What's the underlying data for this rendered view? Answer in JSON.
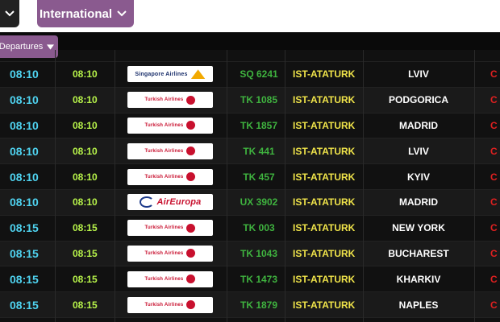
{
  "header": {
    "tab_international": "International",
    "departures_label": "Departures"
  },
  "flights": [
    {
      "scheduled": "08:10",
      "actual": "08:10",
      "airline": "Singapore Airlines",
      "logo": "sq",
      "flight": "SQ 6241",
      "from": "IST-ATATURK",
      "city": "LVIV",
      "status": "C"
    },
    {
      "scheduled": "08:10",
      "actual": "08:10",
      "airline": "Turkish Airlines",
      "logo": "tk",
      "flight": "TK 1085",
      "from": "IST-ATATURK",
      "city": "PODGORICA",
      "status": "C"
    },
    {
      "scheduled": "08:10",
      "actual": "08:10",
      "airline": "Turkish Airlines",
      "logo": "tk",
      "flight": "TK 1857",
      "from": "IST-ATATURK",
      "city": "MADRID",
      "status": "C"
    },
    {
      "scheduled": "08:10",
      "actual": "08:10",
      "airline": "Turkish Airlines",
      "logo": "tk",
      "flight": "TK 441",
      "from": "IST-ATATURK",
      "city": "LVIV",
      "status": "C"
    },
    {
      "scheduled": "08:10",
      "actual": "08:10",
      "airline": "Turkish Airlines",
      "logo": "tk",
      "flight": "TK 457",
      "from": "IST-ATATURK",
      "city": "KYIV",
      "status": "C"
    },
    {
      "scheduled": "08:10",
      "actual": "08:10",
      "airline": "AirEuropa",
      "logo": "ae",
      "flight": "UX 3902",
      "from": "IST-ATATURK",
      "city": "MADRID",
      "status": "C"
    },
    {
      "scheduled": "08:15",
      "actual": "08:15",
      "airline": "Turkish Airlines",
      "logo": "tk",
      "flight": "TK 003",
      "from": "IST-ATATURK",
      "city": "NEW YORK",
      "status": "C"
    },
    {
      "scheduled": "08:15",
      "actual": "08:15",
      "airline": "Turkish Airlines",
      "logo": "tk",
      "flight": "TK 1043",
      "from": "IST-ATATURK",
      "city": "BUCHAREST",
      "status": "C"
    },
    {
      "scheduled": "08:15",
      "actual": "08:15",
      "airline": "Turkish Airlines",
      "logo": "tk",
      "flight": "TK 1473",
      "from": "IST-ATATURK",
      "city": "KHARKIV",
      "status": "C"
    },
    {
      "scheduled": "08:15",
      "actual": "08:15",
      "airline": "Turkish Airlines",
      "logo": "tk",
      "flight": "TK 1879",
      "from": "IST-ATATURK",
      "city": "NAPLES",
      "status": "C"
    }
  ],
  "colors": {
    "scheduled": "#4fd3f0",
    "actual": "#b7f34a",
    "flight": "#3fb33f",
    "from": "#f0e44a",
    "city": "#ffffff",
    "status": "#e02020",
    "accent": "#8a5a8f"
  }
}
